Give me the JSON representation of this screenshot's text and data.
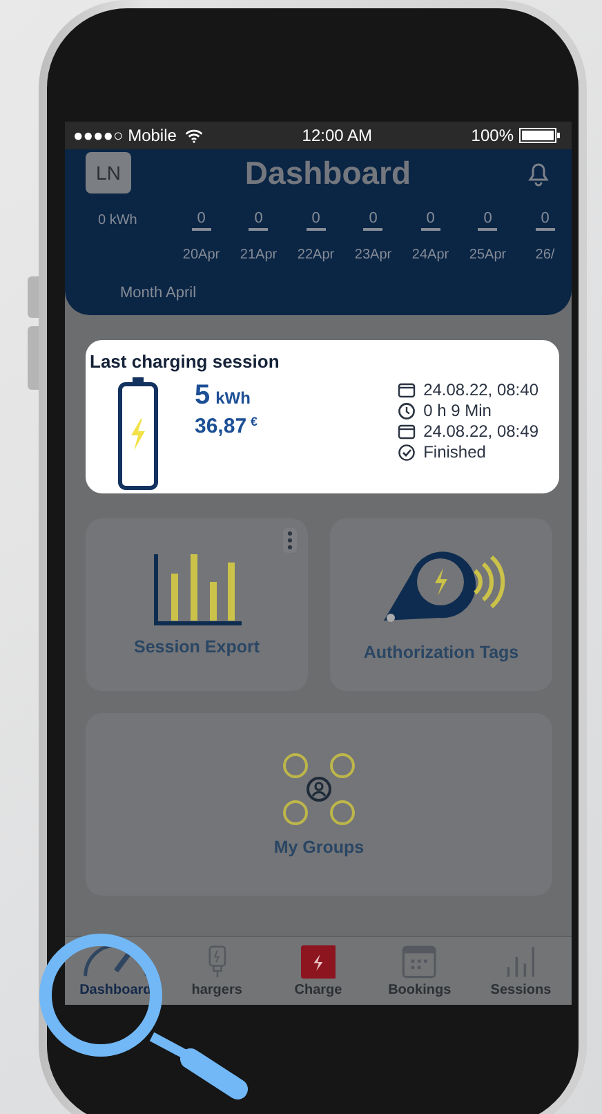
{
  "status_bar": {
    "carrier": "●●●●○ Mobile",
    "time": "12:00 AM",
    "battery": "100%"
  },
  "header": {
    "avatar": "LN",
    "title": "Dashboard",
    "unit_label": "0 kWh",
    "days": [
      {
        "value": "0",
        "date": "20Apr"
      },
      {
        "value": "0",
        "date": "21Apr"
      },
      {
        "value": "0",
        "date": "22Apr"
      },
      {
        "value": "0",
        "date": "23Apr"
      },
      {
        "value": "0",
        "date": "24Apr"
      },
      {
        "value": "0",
        "date": "25Apr"
      },
      {
        "value": "0",
        "date": "26/"
      }
    ],
    "period": "Month April"
  },
  "last_session": {
    "title": "Last charging session",
    "energy": "5",
    "energy_unit": "kWh",
    "cost": "36,87",
    "currency": "€",
    "start": "24.08.22, 08:40",
    "duration": "0 h 9 Min",
    "end": "24.08.22, 08:49",
    "status": "Finished"
  },
  "tiles": [
    {
      "label": "Session Export",
      "kind": "export",
      "menu": true
    },
    {
      "label": "Authorization Tags",
      "kind": "tags",
      "menu": false
    },
    {
      "label": "My Groups",
      "kind": "groups",
      "menu": false
    }
  ],
  "tabs": [
    {
      "label": "Dashboard",
      "kind": "gauge",
      "selected": true
    },
    {
      "label": "hargers",
      "kind": "charger",
      "selected": false
    },
    {
      "label": "Charge",
      "kind": "charge",
      "selected": false
    },
    {
      "label": "Bookings",
      "kind": "calendar",
      "selected": false
    },
    {
      "label": "Sessions",
      "kind": "bars",
      "selected": false
    }
  ]
}
